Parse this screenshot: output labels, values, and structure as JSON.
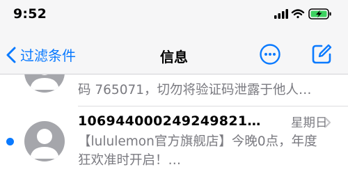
{
  "status_bar": {
    "time": "9:52"
  },
  "nav": {
    "back_label": "过滤条件",
    "title": "信息"
  },
  "messages": [
    {
      "preview": "码 765071，切勿将验证码泄露于他人…",
      "unread": false
    },
    {
      "sender": "106944000249249821…",
      "date": "星期日",
      "preview": "【lululemon官方旗舰店】今晚0点，年度狂欢准时开启！…",
      "unread": true
    }
  ],
  "colors": {
    "accent": "#0a7aff",
    "battery": "#3dd160",
    "avatar": "#a5a6ab"
  }
}
